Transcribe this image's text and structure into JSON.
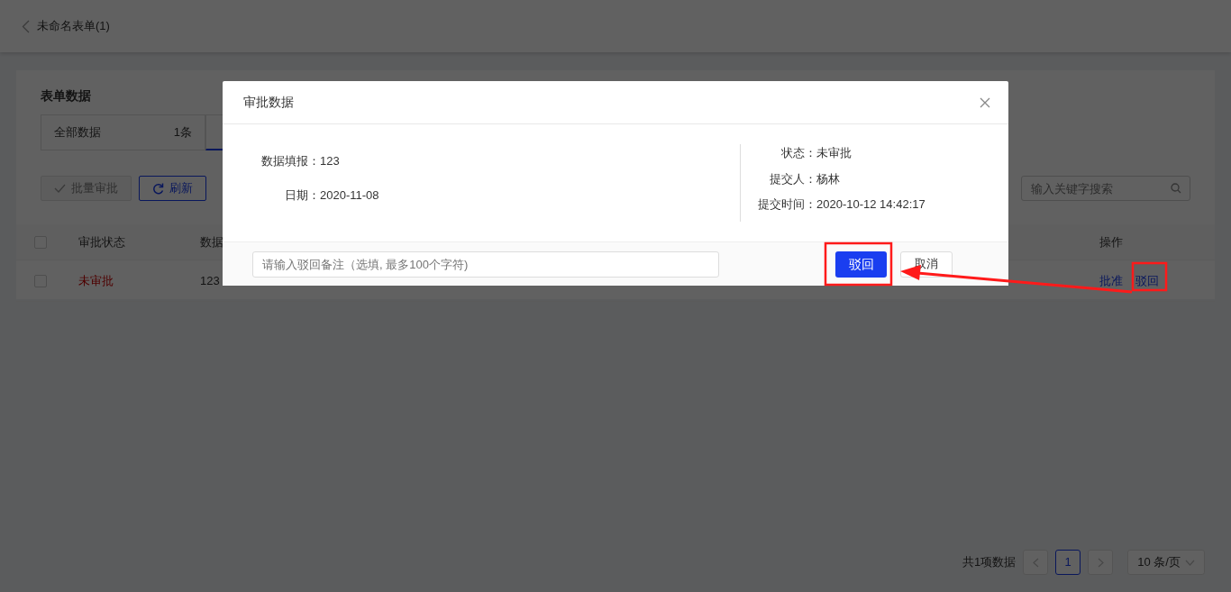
{
  "header": {
    "title": "未命名表单(1)"
  },
  "card": {
    "title": "表单数据",
    "tabs": [
      {
        "label": "全部数据",
        "count": "1条",
        "selected": false
      },
      {
        "selected": true
      }
    ],
    "buttons": [
      {
        "label": "批量审批",
        "kind": "approve",
        "disabled": true
      },
      {
        "label": "刷新",
        "kind": "refresh",
        "disabled": false
      }
    ],
    "search": {
      "placeholder": "输入关键字搜索"
    },
    "table": {
      "select_all": {
        "checked": false
      },
      "columns": [
        "审批状态",
        "数据",
        "操作"
      ],
      "rows": [
        {
          "checked": false,
          "status": "未审批",
          "data": "123",
          "actions": [
            "批准",
            "驳回"
          ]
        }
      ]
    }
  },
  "pagination": {
    "total": "共1项数据",
    "pages": [
      {
        "label": "1",
        "selected": true
      }
    ],
    "page_size": "10 条/页"
  },
  "modal": {
    "title": "审批数据",
    "left_fields": [
      {
        "label": "数据填报：",
        "value": "123"
      },
      {
        "label": "日期：",
        "value": "2020-11-08"
      }
    ],
    "right_fields": [
      {
        "label": "状态：",
        "value": "未审批"
      },
      {
        "label": "提交人：",
        "value": "杨林"
      },
      {
        "label": "提交时间：",
        "value": "2020-10-12 14:42:17"
      }
    ],
    "remark": {
      "placeholder": "请输入驳回备注（选填, 最多100个字符)"
    },
    "buttons": [
      {
        "label": "驳回",
        "kind": "primary"
      },
      {
        "label": "取消",
        "kind": "default"
      }
    ]
  }
}
